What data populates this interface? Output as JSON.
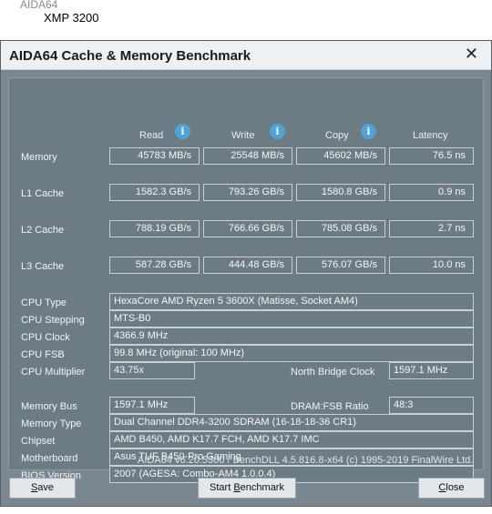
{
  "background": {
    "app_label": "AIDA64",
    "file_label": "XMP 3200"
  },
  "window": {
    "title": "AIDA64 Cache & Memory Benchmark",
    "close_glyph": "✕"
  },
  "columns": {
    "read": "Read",
    "write": "Write",
    "copy": "Copy",
    "latency": "Latency",
    "info_glyph": "i"
  },
  "rows": {
    "memory": {
      "label": "Memory",
      "read": "45783 MB/s",
      "write": "25548 MB/s",
      "copy": "45602 MB/s",
      "latency": "76.5 ns"
    },
    "l1": {
      "label": "L1 Cache",
      "read": "1582.3 GB/s",
      "write": "793.26 GB/s",
      "copy": "1580.8 GB/s",
      "latency": "0.9 ns"
    },
    "l2": {
      "label": "L2 Cache",
      "read": "788.19 GB/s",
      "write": "766.66 GB/s",
      "copy": "785.08 GB/s",
      "latency": "2.7 ns"
    },
    "l3": {
      "label": "L3 Cache",
      "read": "587.28 GB/s",
      "write": "444.48 GB/s",
      "copy": "576.07 GB/s",
      "latency": "10.0 ns"
    }
  },
  "cpu": {
    "type_label": "CPU Type",
    "type_value": "HexaCore AMD Ryzen 5 3600X  (Matisse, Socket AM4)",
    "stepping_label": "CPU Stepping",
    "stepping_value": "MTS-B0",
    "clock_label": "CPU Clock",
    "clock_value": "4366.9 MHz",
    "fsb_label": "CPU FSB",
    "fsb_value": "99.8 MHz  (original: 100 MHz)",
    "multiplier_label": "CPU Multiplier",
    "multiplier_value": "43.75x",
    "nb_clock_label": "North Bridge Clock",
    "nb_clock_value": "1597.1 MHz"
  },
  "memory_info": {
    "bus_label": "Memory Bus",
    "bus_value": "1597.1 MHz",
    "ratio_label": "DRAM:FSB Ratio",
    "ratio_value": "48:3",
    "type_label": "Memory Type",
    "type_value": "Dual Channel DDR4-3200 SDRAM  (16-18-18-36 CR1)",
    "chipset_label": "Chipset",
    "chipset_value": "AMD B450, AMD K17.7 FCH, AMD K17.7 IMC",
    "motherboard_label": "Motherboard",
    "motherboard_value": "Asus TUF B450-Pro Gaming",
    "bios_label": "BIOS Version",
    "bios_value": "2007  (AGESA: Combo-AM4 1.0.0.4)"
  },
  "footer": "AIDA64 v6.20.5300 / BenchDLL 4.5.816.8-x64  (c) 1995-2019 FinalWire Ltd.",
  "buttons": {
    "save_u": "S",
    "save_rest": "ave",
    "start_pre": "Start ",
    "start_u": "B",
    "start_rest": "enchmark",
    "close_u": "C",
    "close_rest": "lose"
  }
}
